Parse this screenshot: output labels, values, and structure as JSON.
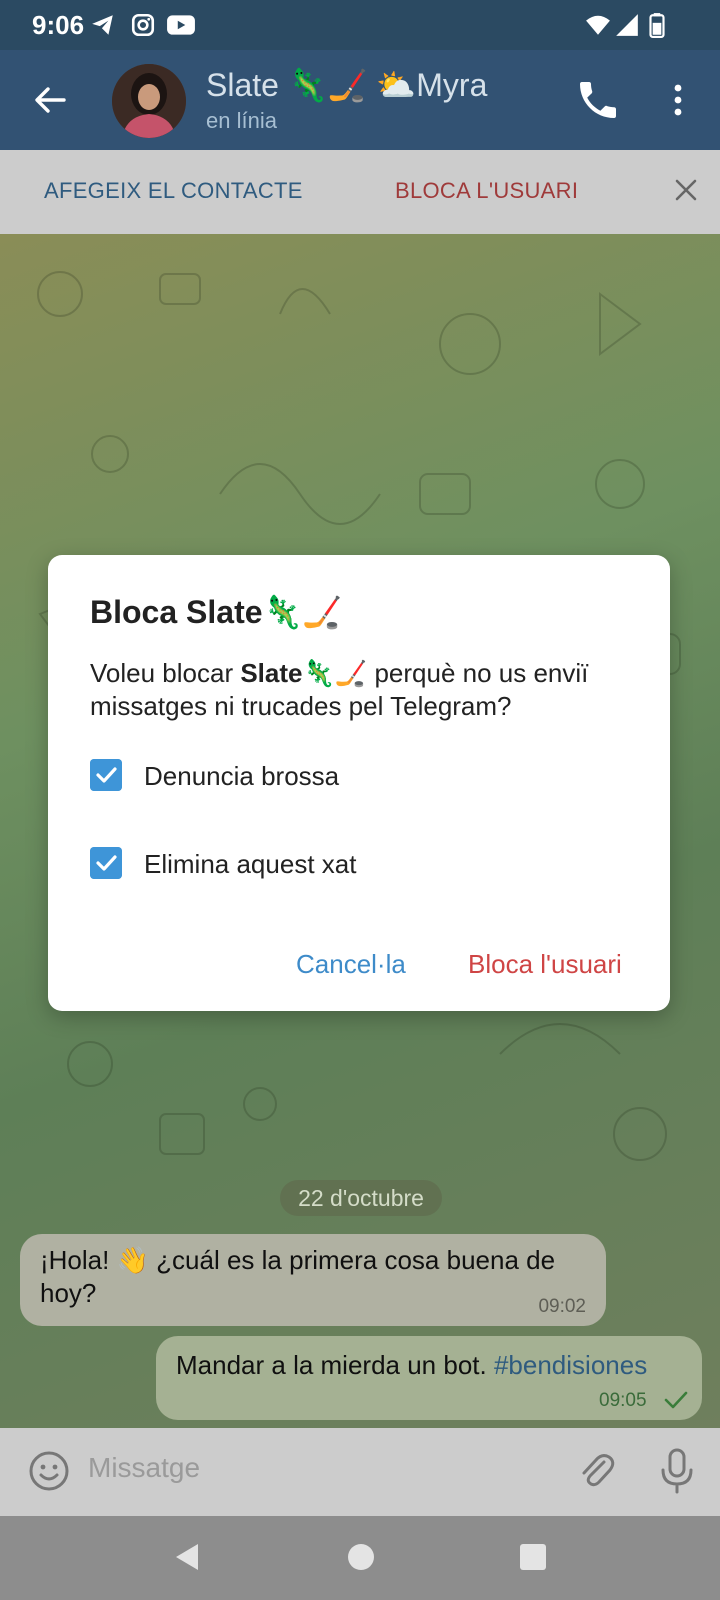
{
  "status_bar": {
    "time": "9:06"
  },
  "header": {
    "title": "Slate 🦎🏒 ⛅Myra",
    "status": "en línia"
  },
  "action_bar": {
    "add_contact": "AFEGEIX EL CONTACTE",
    "block_user": "BLOCA L'USUARI"
  },
  "chat": {
    "date": "22 d'octubre",
    "messages": [
      {
        "text": "¡Hola! 👋 ¿cuál es la primera cosa buena de hoy?",
        "time": "09:02",
        "direction": "in"
      },
      {
        "text": "Mandar a la mierda un bot.",
        "hashtag": "#bendisiones",
        "time": "09:05",
        "direction": "out"
      }
    ]
  },
  "dialog": {
    "title": "Bloca Slate🦎🏒",
    "body_prefix": "Voleu blocar ",
    "body_name": "Slate🦎🏒",
    "body_suffix": " perquè no us enviï missatges ni trucades pel Telegram?",
    "options": [
      {
        "label": "Denuncia brossa",
        "checked": true
      },
      {
        "label": "Elimina aquest xat",
        "checked": true
      }
    ],
    "cancel": "Cancel·la",
    "confirm": "Bloca l'usuari"
  },
  "input": {
    "placeholder": "Missatge"
  },
  "colors": {
    "header": "#325273",
    "accent_blue": "#3e95d8",
    "danger_red": "#cf4545"
  }
}
